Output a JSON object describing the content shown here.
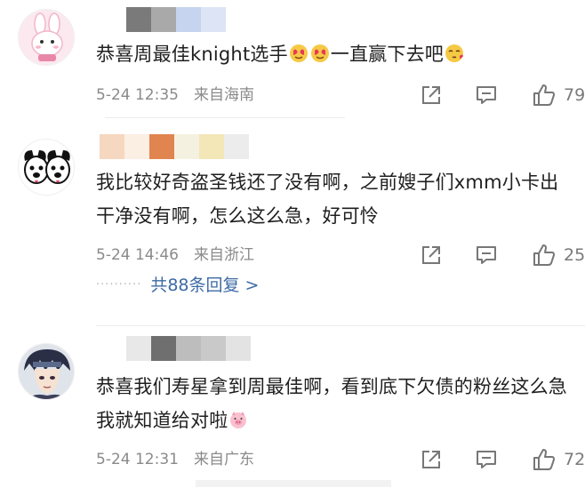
{
  "comments": [
    {
      "text": "恭喜周最佳knight选手",
      "text_after": "一直赢下去吧",
      "time": "5-24 12:35",
      "location": "来自海南",
      "likes": "79",
      "avatar": "rabbit-character-avatar",
      "mosaic_colors": [
        "#7a7a7a",
        "#a9a9a9",
        "#c6d4ef",
        "#dde4f5"
      ]
    },
    {
      "text": "我比较好奇盗圣钱还了没有啊，之前嫂子们xmm小卡出干净没有啊，怎么这么急，好可怜",
      "time": "5-24 14:46",
      "location": "来自浙江",
      "likes": "25",
      "avatar": "cartoon-dogs-avatar",
      "mosaic_colors": [
        "#f6d7bf",
        "#fbeee3",
        "#e08550",
        "#f5f1e0",
        "#f3e7b8",
        "#ececec"
      ],
      "replies_label": "共88条回复 >"
    },
    {
      "text": "恭喜我们寿星拿到周最佳啊，看到底下欠债的粉丝这么急我就知道给对啦",
      "time": "5-24 12:31",
      "location": "来自广东",
      "likes": "72",
      "avatar": "anime-character-avatar",
      "mosaic_colors": [
        "#e8e8e8",
        "#6f6f6f",
        "#bdbdbd",
        "#c9c9c9",
        "#e3e3e3"
      ]
    }
  ],
  "icons": {
    "share": "share-icon",
    "comment": "comment-icon",
    "like": "thumbs-up-icon"
  },
  "colors": {
    "meta_text": "#8a8a8a",
    "reply_link": "#3d6aa5"
  }
}
